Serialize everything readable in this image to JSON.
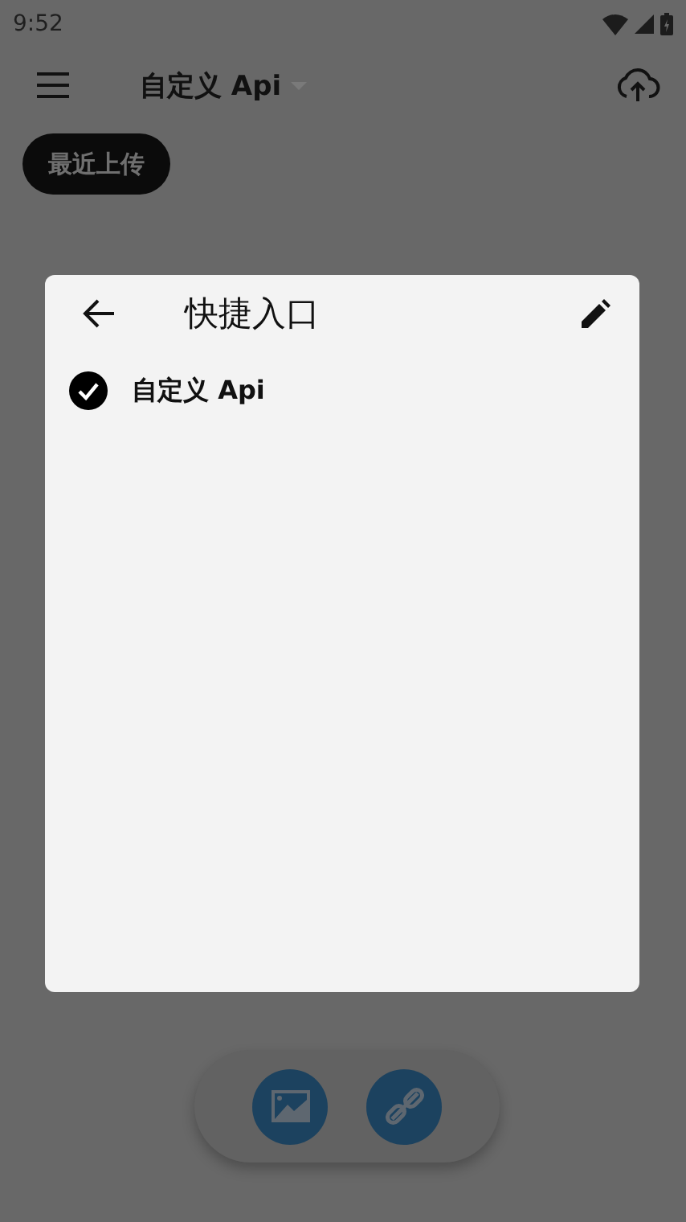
{
  "status_bar": {
    "time": "9:52"
  },
  "app_bar": {
    "title": "自定义 Api"
  },
  "chip": {
    "label": "最近上传"
  },
  "dialog": {
    "title": "快捷入口",
    "items": [
      {
        "label": "自定义 Api",
        "checked": true
      }
    ]
  }
}
